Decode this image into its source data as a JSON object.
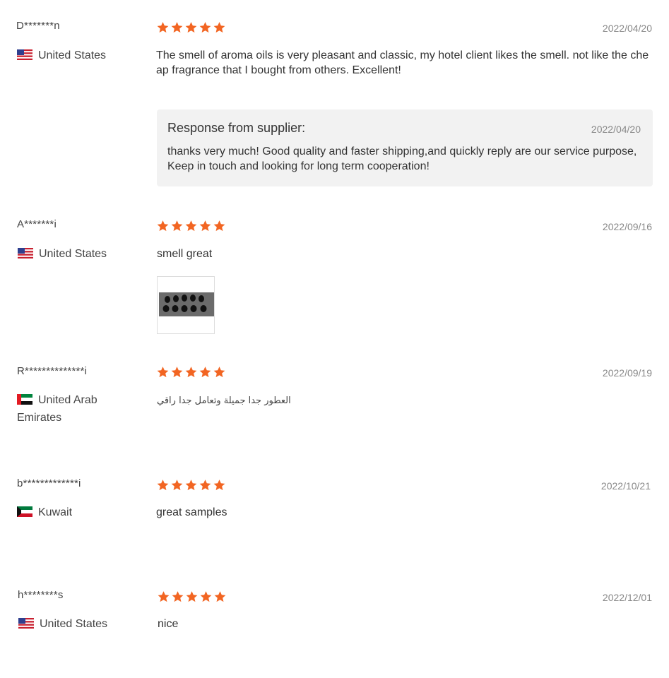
{
  "reviews": [
    {
      "user": "D*******n",
      "country": "United States",
      "flag": "us-flag",
      "rating": 5,
      "date": "2022/04/20",
      "text": "The smell of aroma oils is very pleasant and classic, my hotel client likes the smell. not like the cheap fragrance that I bought from others. Excellent!",
      "response": {
        "title": "Response from supplier:",
        "date": "2022/04/20",
        "text": "thanks very much! Good quality and faster shipping,and quickly reply are our service purpose,Keep in touch and looking for long term cooperation!"
      }
    },
    {
      "user": "A*******i",
      "country": "United States",
      "flag": "us-flag",
      "rating": 5,
      "date": "2022/09/16",
      "text": "smell great",
      "has_photo": true
    },
    {
      "user": "R**************i",
      "country": "United Arab Emirates",
      "flag": "uae-flag",
      "rating": 5,
      "date": "2022/09/19",
      "text": "العطور جدا جميلة وتعامل جدا راقي"
    },
    {
      "user": "b*************i",
      "country": "Kuwait",
      "flag": "kuwait-flag",
      "rating": 5,
      "date": "2022/10/21",
      "text": "great samples"
    },
    {
      "user": "h********s",
      "country": "United States",
      "flag": "us-flag",
      "rating": 5,
      "date": "2022/12/01",
      "text": "nice"
    }
  ],
  "colors": {
    "star": "#f26522",
    "response_bg": "#f2f2f2",
    "date": "#888888"
  }
}
